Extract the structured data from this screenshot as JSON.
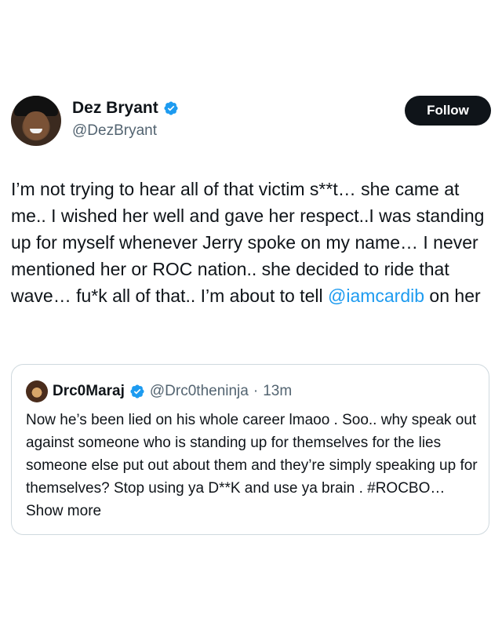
{
  "tweet": {
    "author": {
      "display_name": "Dez Bryant",
      "handle": "@DezBryant",
      "verified_icon": "verified-badge-icon"
    },
    "follow_label": "Follow",
    "text_before_mention": "I’m not trying to hear all of that victim s**t… she came at me.. I wished her well and gave her respect..I was standing up for myself whenever Jerry spoke on my name… I never mentioned her or ROC nation.. she decided to ride that wave…  fu*k all of that.. I’m about to tell ",
    "mention": "@iamcardib",
    "text_after_mention": " on her"
  },
  "quote": {
    "display_name": "Drc0Maraj",
    "handle": "@Drc0theninja",
    "separator": "·",
    "time": "13m",
    "text": "Now he’s been lied on his whole career lmaoo . Soo.. why speak out against someone who is standing up for themselves for the lies someone else put out about them and they’re simply speaking up for themselves? Stop using ya D**K and use ya brain . #ROCBO…",
    "show_more": "Show more"
  },
  "colors": {
    "text": "#0f1419",
    "secondary": "#536471",
    "link": "#1d9bf0",
    "border": "#cfd9de"
  }
}
